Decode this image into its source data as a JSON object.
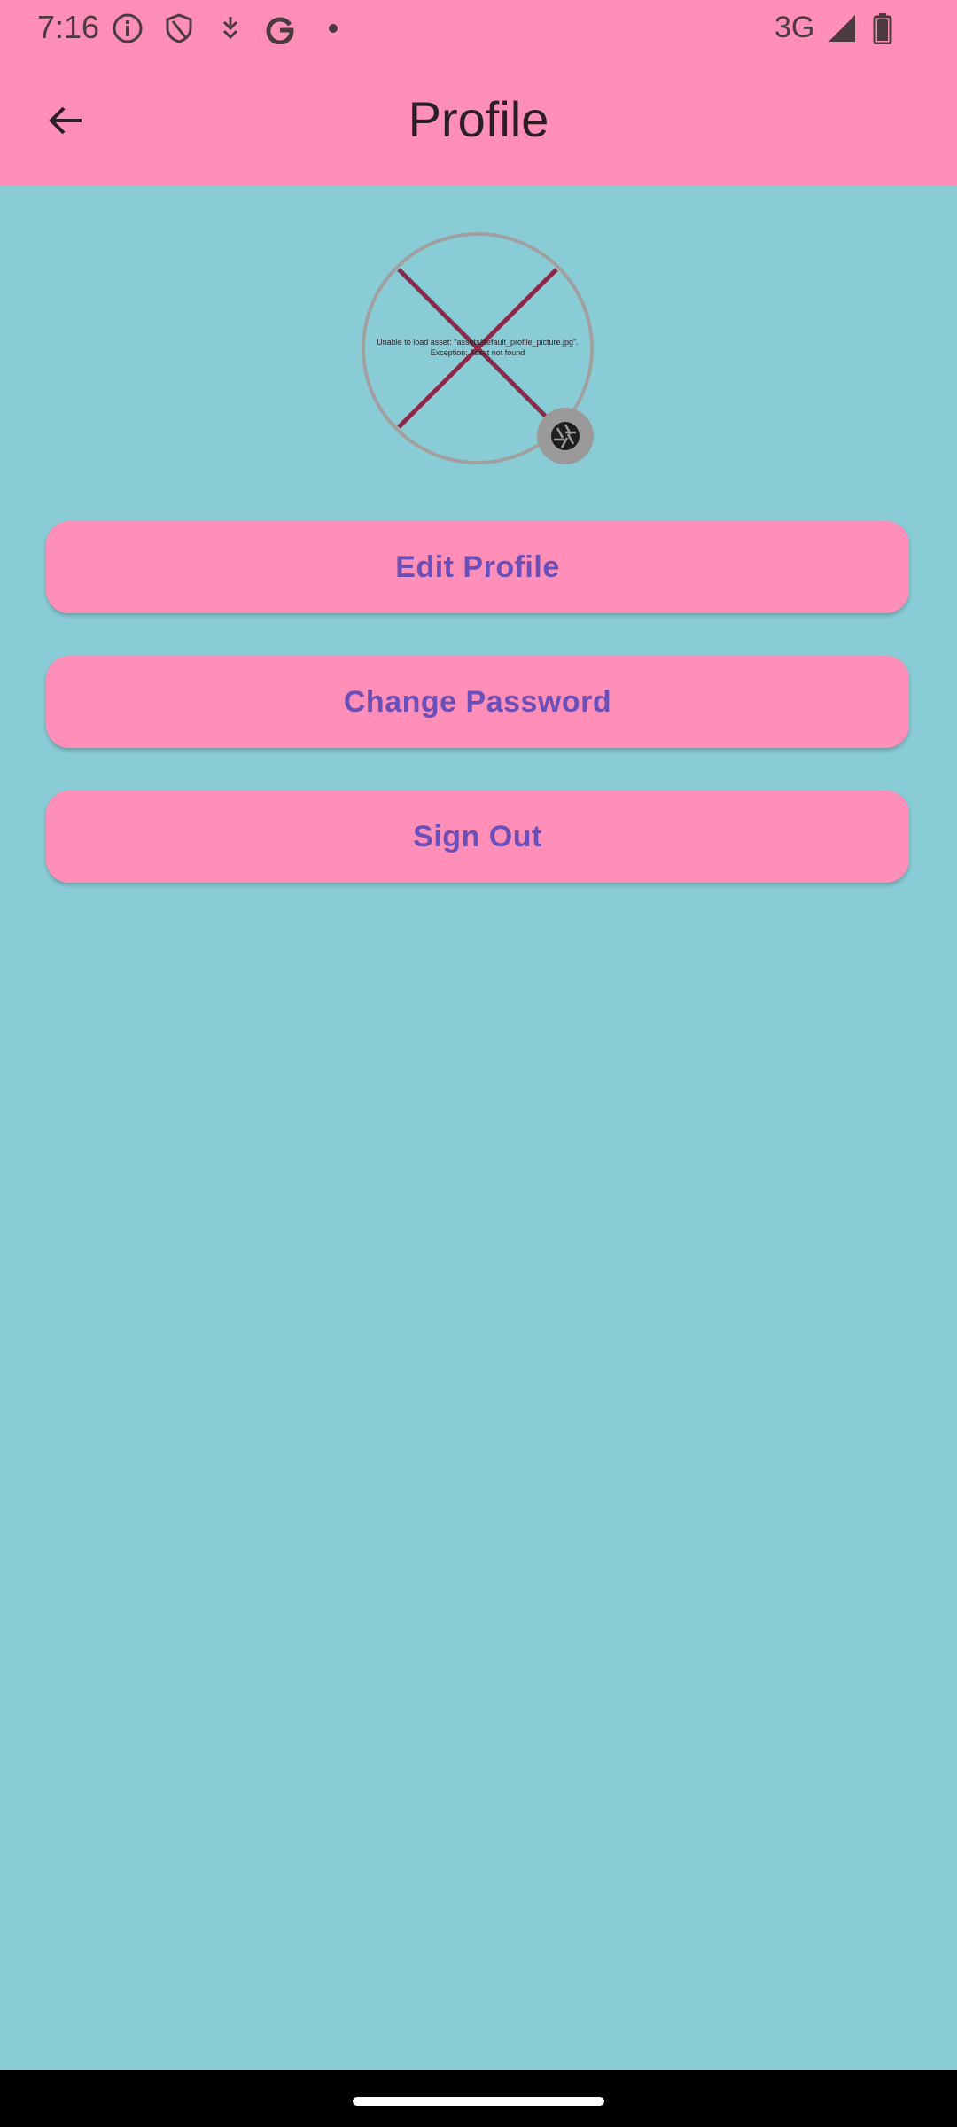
{
  "status_bar": {
    "time": "7:16",
    "icons": [
      "info-icon",
      "shield-icon",
      "download-icon",
      "google-icon",
      "dot-icon"
    ],
    "network": "3G",
    "right_icons": [
      "signal-icon",
      "battery-icon"
    ]
  },
  "app_bar": {
    "title": "Profile",
    "back_icon": "arrow-left-icon"
  },
  "avatar": {
    "error_line1": "Unable to load asset: \"assets/default_profile_picture.jpg\".",
    "error_line2": "Exception: Asset not found",
    "camera_icon": "camera-aperture-icon"
  },
  "actions": {
    "edit_profile": "Edit Profile",
    "change_password": "Change Password",
    "sign_out": "Sign Out"
  },
  "colors": {
    "app_bar": "#FF8FB8",
    "background": "#8ACCD6",
    "button": "#FF8FB8",
    "button_text": "#6B4FB8",
    "error_cross": "#8B2A4A"
  }
}
